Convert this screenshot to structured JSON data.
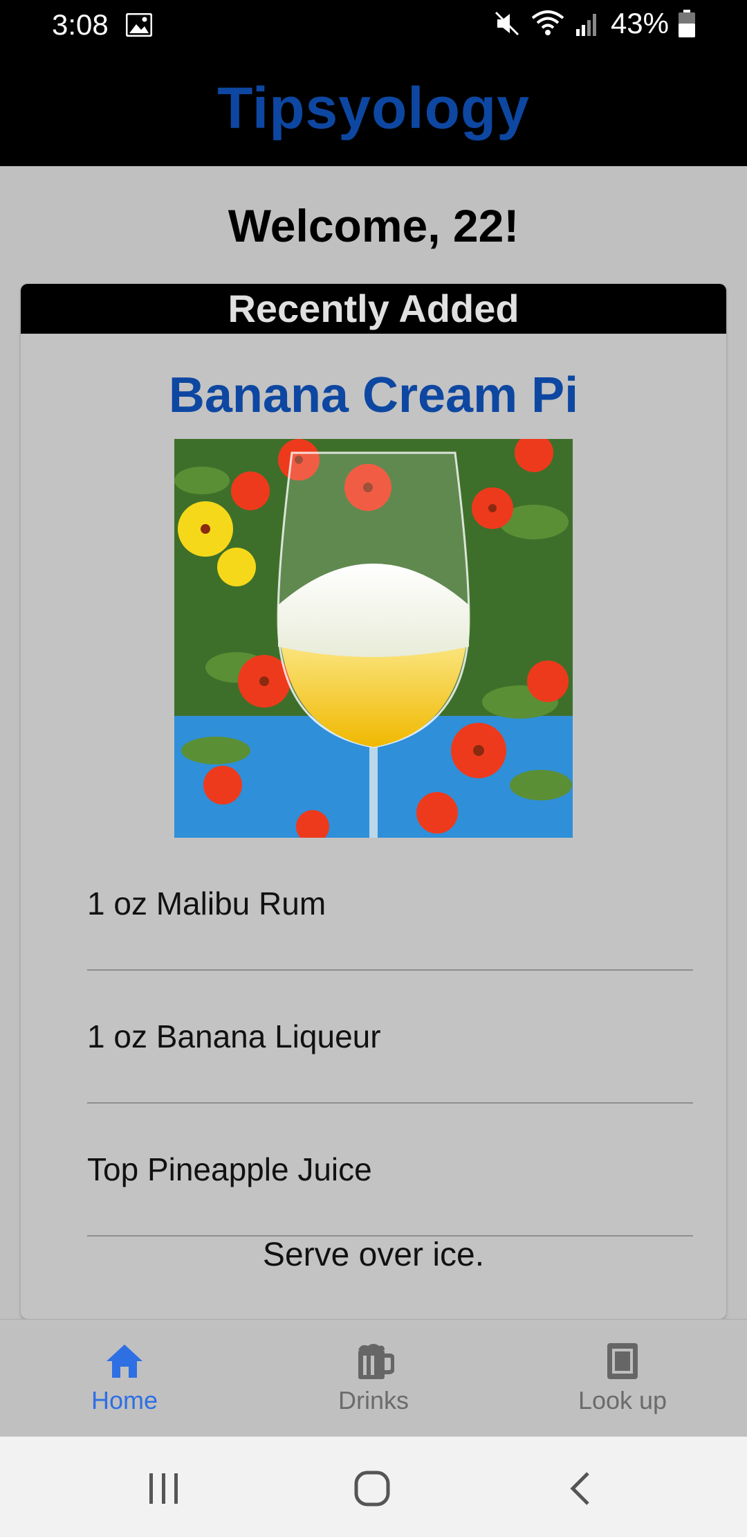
{
  "status_bar": {
    "time": "3:08",
    "battery": "43%",
    "icons": [
      "image-icon",
      "mute-icon",
      "wifi-icon",
      "signal-icon",
      "battery-icon"
    ]
  },
  "app": {
    "title": "Tipsyology",
    "title_color": "#0d47a1"
  },
  "welcome_text": "Welcome, 22!",
  "recent_card": {
    "header": "Recently Added",
    "drink_name": "Banana Cream Pi",
    "ingredients": [
      "1 oz Malibu Rum",
      "1 oz Banana Liqueur",
      "Top Pineapple Juice"
    ],
    "instructions": "Serve over ice."
  },
  "bottom_nav": {
    "active_color": "#2f6fe4",
    "items": [
      {
        "label": "Home",
        "icon": "home-icon",
        "active": true
      },
      {
        "label": "Drinks",
        "icon": "beer-mug-icon",
        "active": false
      },
      {
        "label": "Look up",
        "icon": "book-icon",
        "active": false
      }
    ]
  },
  "system_nav": {
    "icons": [
      "recents-icon",
      "home-circle-icon",
      "back-icon"
    ]
  }
}
